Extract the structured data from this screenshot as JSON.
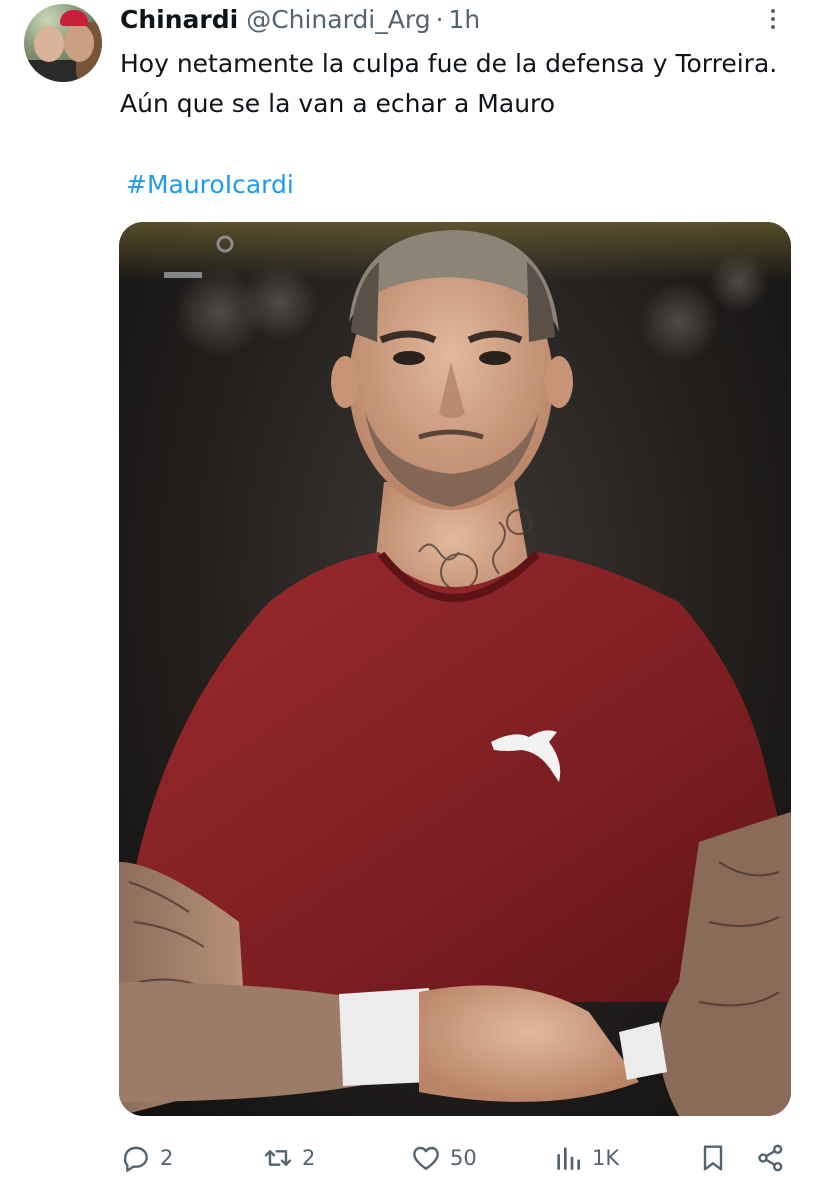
{
  "author": {
    "display_name": "Chinardi",
    "handle": "@Chinardi_Arg",
    "separator": "·",
    "time": "1h"
  },
  "tweet": {
    "text": "Hoy netamente la culpa fue de la defensa y Torreira. Aún que se la van a echar a Mauro",
    "hashtag": "#MauroIcardi"
  },
  "media": {
    "type": "photo",
    "description_icon": "photo"
  },
  "actions": {
    "reply_count": "2",
    "retweet_count": "2",
    "like_count": "50",
    "views_count": "1K"
  },
  "colors": {
    "accent": "#1d9bf0",
    "muted": "#536471",
    "text": "#0f1419",
    "jersey": "#7d1e22"
  },
  "icons": [
    "more-icon",
    "reply-icon",
    "retweet-icon",
    "like-icon",
    "views-icon",
    "bookmark-icon",
    "share-icon"
  ]
}
